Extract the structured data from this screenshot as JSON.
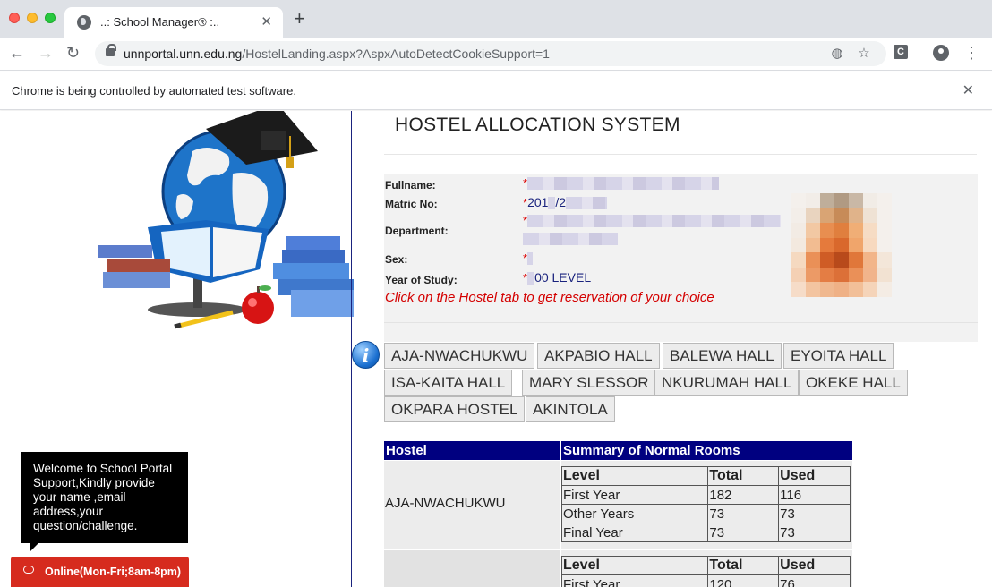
{
  "browser": {
    "tab_title": "..: School Manager® :..",
    "url_host": "unnportal.unn.edu.ng",
    "url_path": "/HostelLanding.aspx?AspxAutoDetectCookieSupport=1",
    "infobar_text": "Chrome is being controlled by automated test software.",
    "extension_badge": "C"
  },
  "page": {
    "title": "HOSTEL ALLOCATION SYSTEM",
    "student": {
      "fullname_label": "Fullname:",
      "matric_label": "Matric No:",
      "matric_value": "201",
      "matric_value_tail": "/2",
      "department_label": "Department:",
      "sex_label": "Sex:",
      "year_label": "Year of Study:",
      "year_value_tail": "00 LEVEL",
      "required_mark": "*"
    },
    "instruction": "Click on the Hostel tab to get reservation of your choice",
    "halls": [
      "AJA-NWACHUKWU",
      "AKPABIO HALL",
      "BALEWA HALL",
      "EYOITA HALL",
      "ISA-KAITA HALL",
      "MARY SLESSOR",
      "NKURUMAH HALL",
      "OKEKE HALL",
      "OKPARA HOSTEL",
      "AKINTOLA"
    ],
    "summary": {
      "col_hostel": "Hostel",
      "col_summary": "Summary of Normal Rooms",
      "inner_headers": [
        "Level",
        "Total",
        "Used"
      ],
      "rows": [
        {
          "hostel": "AJA-NWACHUKWU",
          "levels": [
            {
              "level": "First Year",
              "total": "182",
              "used": "116"
            },
            {
              "level": "Other Years",
              "total": "73",
              "used": "73"
            },
            {
              "level": "Final Year",
              "total": "73",
              "used": "73"
            }
          ]
        },
        {
          "hostel": "",
          "levels": [
            {
              "level": "First Year",
              "total": "120",
              "used": "76"
            }
          ]
        }
      ]
    }
  },
  "chat": {
    "message": "Welcome to School Portal Support,Kindly provide your name ,email address,your question/challenge.",
    "button_label": "Online(Mon-Fri;8am-8pm)"
  },
  "colors": {
    "accent_navy": "#000080",
    "instruction_red": "#d40000",
    "chat_red": "#d62b1e"
  }
}
